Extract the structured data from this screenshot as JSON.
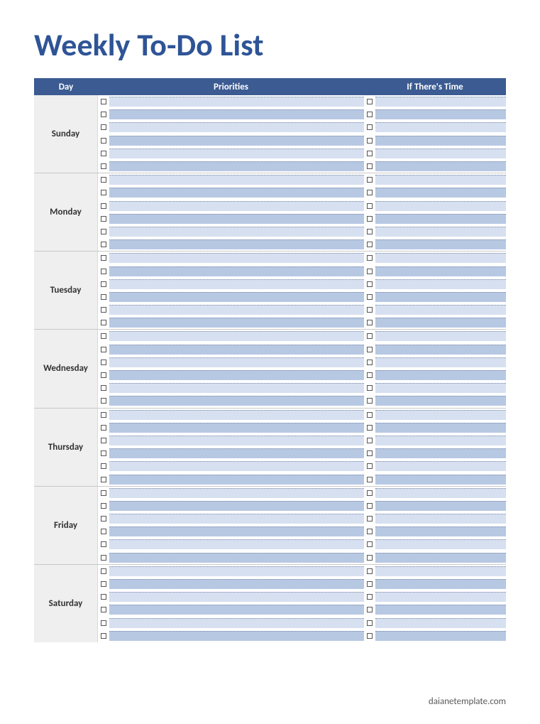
{
  "title": "Weekly To-Do List",
  "columns": {
    "day": "Day",
    "priorities": "Priorities",
    "if_time": "If There's Time"
  },
  "days": [
    {
      "name": "Sunday",
      "rows": 6
    },
    {
      "name": "Monday",
      "rows": 6
    },
    {
      "name": "Tuesday",
      "rows": 6
    },
    {
      "name": "Wednesday",
      "rows": 6
    },
    {
      "name": "Thursday",
      "rows": 6
    },
    {
      "name": "Friday",
      "rows": 6
    },
    {
      "name": "Saturday",
      "rows": 6
    }
  ],
  "footer": "daianetemplate.com"
}
